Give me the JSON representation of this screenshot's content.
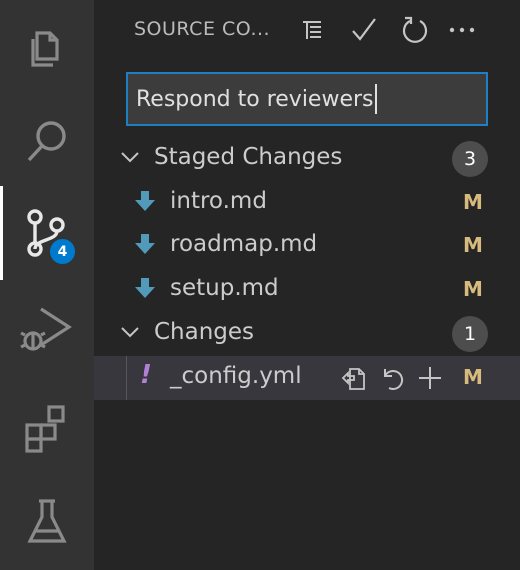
{
  "activity_bar": {
    "items": [
      "explorer-icon",
      "search-icon",
      "source-control-icon",
      "run-debug-icon",
      "extensions-icon",
      "testing-icon"
    ],
    "scm_badge": "4",
    "accent_color": "#007acc"
  },
  "sidebar": {
    "title": "SOURCE CO...",
    "header_actions": [
      "view-as-tree-icon",
      "commit-check-icon",
      "refresh-icon",
      "more-actions-icon"
    ]
  },
  "commit": {
    "message": "Respond to reviewers"
  },
  "staged": {
    "label": "Staged Changes",
    "count": "3",
    "files": [
      {
        "name": "intro.md",
        "status": "M"
      },
      {
        "name": "roadmap.md",
        "status": "M"
      },
      {
        "name": "setup.md",
        "status": "M"
      }
    ]
  },
  "changes": {
    "label": "Changes",
    "count": "1",
    "files": [
      {
        "name": "_config.yml",
        "status": "M",
        "icon": "!"
      }
    ]
  },
  "colors": {
    "modified": "#d7ba7d",
    "yaml_icon": "#b180d7",
    "staged_arrow": "#519aba"
  }
}
